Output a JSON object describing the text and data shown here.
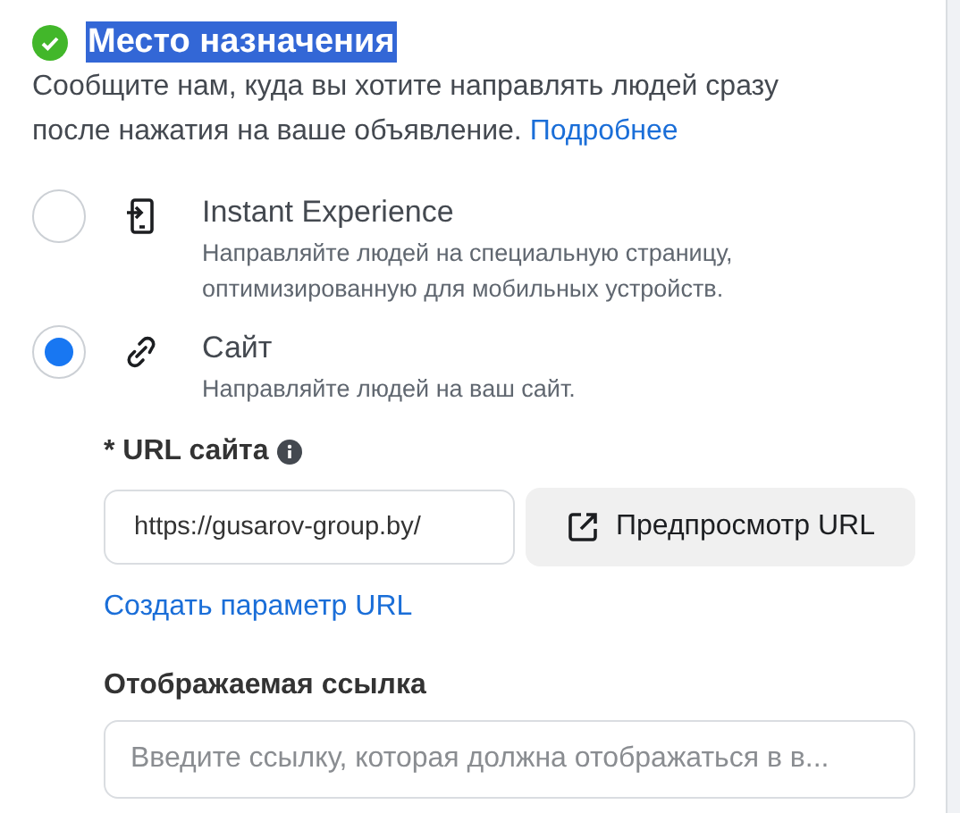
{
  "section": {
    "title": "Место назначения",
    "complete": true,
    "description": "Сообщите нам, куда вы хотите направлять людей сразу после нажатия на ваше объявление.",
    "learn_more": "Подробнее"
  },
  "options": [
    {
      "title": "Instant Experience",
      "description": "Направляйте людей на специальную страницу, оптимизированную для мобильных устройств.",
      "selected": false
    },
    {
      "title": "Сайт",
      "description": "Направляйте людей на ваш сайт.",
      "selected": true
    }
  ],
  "url": {
    "label": "* URL сайта",
    "value": "https://gusarov-group.by/",
    "preview_button": "Предпросмотр URL",
    "param_link": "Создать параметр URL"
  },
  "display_link": {
    "label": "Отображаемая ссылка",
    "placeholder": "Введите ссылку, которая должна отображаться в в..."
  }
}
